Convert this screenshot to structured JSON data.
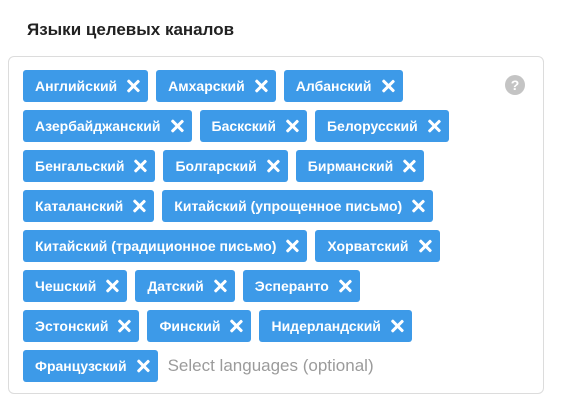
{
  "section_title": "Языки целевых каналов",
  "help_icon": "?",
  "rows": [
    [
      "Английский",
      "Амхарский",
      "Албанский"
    ],
    [
      "Азербайджанский",
      "Баскский",
      "Белорусский"
    ],
    [
      "Бенгальский",
      "Болгарский",
      "Бирманский"
    ],
    [
      "Каталанский",
      "Китайский (упрощенное письмо)"
    ],
    [
      "Китайский (традиционное письмо)",
      "Хорватский"
    ],
    [
      "Чешский",
      "Датский",
      "Эсперанто"
    ],
    [
      "Эстонский",
      "Финский",
      "Нидерландский"
    ],
    [
      "Французский"
    ]
  ],
  "input": {
    "placeholder": "Select languages (optional)",
    "value": ""
  },
  "colors": {
    "chip_bg": "#3d9ae8",
    "chip_text": "#ffffff",
    "border": "#dcdcdc",
    "help_icon_bg": "#c4c4c4"
  },
  "icons": {
    "remove": "close-icon",
    "help": "question-circle-icon"
  }
}
